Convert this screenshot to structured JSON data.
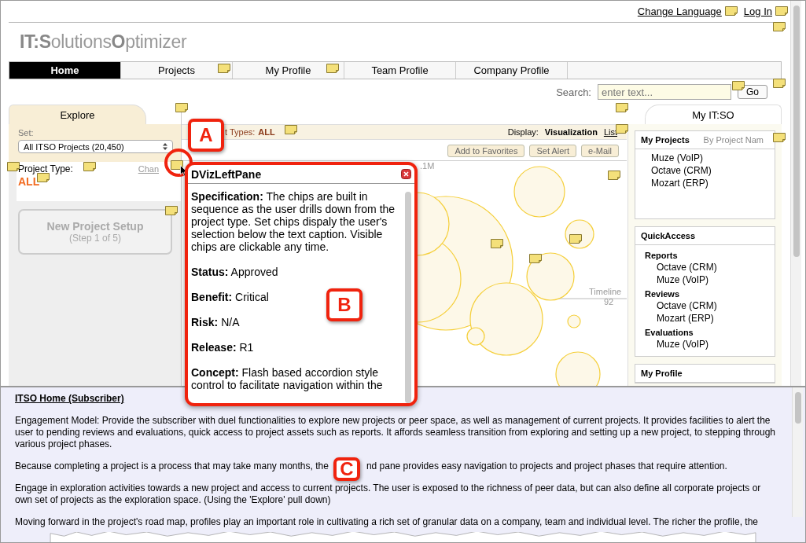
{
  "header": {
    "links": [
      "Change Language",
      "Log In"
    ],
    "logo": "**IT:S**olutions**O**ptimizer"
  },
  "nav": [
    {
      "label": "Home",
      "selected": true
    },
    {
      "label": "Projects",
      "selected": false
    },
    {
      "label": "My Profile",
      "selected": false
    },
    {
      "label": "Team Profile",
      "selected": false
    },
    {
      "label": "Company Profile",
      "selected": false
    }
  ],
  "search": {
    "label": "Search:",
    "placeholder": "enter text...",
    "button": "Go"
  },
  "explore": {
    "tab": "Explore",
    "set_label": "Set:",
    "set_value": "All ITSO Projects (20,450)",
    "project_type_label": "Project Type:",
    "change_link": "Chan",
    "project_type_value": "ALL",
    "setup_button": {
      "title": "New Project Setup",
      "subtitle": "(Step 1 of 5)",
      "disabled": true
    }
  },
  "center": {
    "chip_label": "t Types:",
    "chip_value": "ALL",
    "display_label": "Display:",
    "display_options": [
      {
        "label": "Visualization",
        "selected": true
      },
      {
        "label": "List",
        "selected": false
      }
    ],
    "buttons": [
      "Add to Favorites",
      "Set Alert",
      "e-Mail"
    ],
    "axis_labels": [
      ".1M",
      "Timeline",
      "92"
    ]
  },
  "my_itso": {
    "tab": "My IT:SO",
    "sections": [
      {
        "title": "My Projects",
        "sort": "By Project Nam",
        "groups": [
          {
            "items": [
              "Muze (VoIP)",
              "Octave (CRM)",
              "Mozart (ERP)"
            ]
          }
        ]
      },
      {
        "title": "QuickAccess",
        "groups": [
          {
            "title": "Reports",
            "items": [
              "Octave (CRM)",
              "Muze (VoIP)"
            ]
          },
          {
            "title": "Reviews",
            "items": [
              "Octave (CRM)",
              "Mozart (ERP)"
            ]
          },
          {
            "title": "Evaluations",
            "items": [
              "Muze (VoIP)"
            ]
          }
        ]
      },
      {
        "title": "My Profile"
      }
    ]
  },
  "popup": {
    "title": "DVizLeftPane",
    "fields": [
      {
        "label": "Specification:",
        "text": "The chips are built in sequence as the user drills down from the project type. Set chips dispaly the user's selection below the text caption. Visible chips are clickable any time."
      },
      {
        "label": "Status:",
        "text": "Approved"
      },
      {
        "label": "Benefit:",
        "text": "Critical"
      },
      {
        "label": "Risk:",
        "text": "N/A"
      },
      {
        "label": "Release:",
        "text": "R1"
      },
      {
        "label": "Concept:",
        "text": "Flash based accordion style control to facilitate navigation within the"
      }
    ]
  },
  "description": {
    "title": "ITSO Home (Subscriber)",
    "paragraphs": [
      "Engagement Model: Provide the subscriber with duel functionalities to explore new projects or peer space, as well as management of current projects. It provides facilities to alert the user to pending reviews and evaluations, quick access to project assets such as reports. It affords seamless transition from exploring and setting up a new project, to stepping through various project phases.",
      "Because completing a project is a process that may take many months, the",
      "Engage in exploration activities towards a new project and access to current projects. The user is exposed to the richness of peer data, but can also define all corporate projects or own set of projects as the exploration space. (Using the 'Explore' pull down)",
      "Moving forward in the project's road map, profiles play an important role in cultivating a rich set of granular data on a company, team and individual level. The richer the profile, the"
    ],
    "covered_tail": "nd pane provides easy navigation to projects and project phases that require attention."
  },
  "callouts": [
    "A",
    "B",
    "C"
  ]
}
